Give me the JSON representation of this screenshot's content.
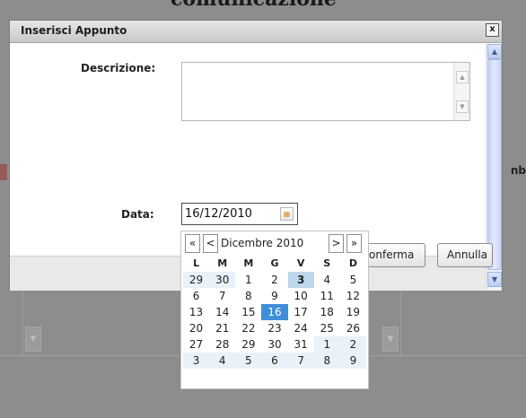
{
  "background": {
    "page_heading": "comunicazione",
    "edge_text": "nb"
  },
  "dialog": {
    "title": "Inserisci Appunto",
    "close_label": "x",
    "description_label": "Descrizione:",
    "description_value": "",
    "date_label": "Data:",
    "date_value": "16/12/2010",
    "confirm_label": "Conferma",
    "cancel_label": "Annulla"
  },
  "calendar": {
    "month_label": "Dicembre 2010",
    "nav": {
      "prev_year": "«",
      "prev_month": "<",
      "next_month": ">",
      "next_year": "»"
    },
    "weekdays": [
      "L",
      "M",
      "M",
      "G",
      "V",
      "S",
      "D"
    ],
    "weeks": [
      [
        "29",
        "30",
        "1",
        "2",
        "3",
        "4",
        "5"
      ],
      [
        "6",
        "7",
        "8",
        "9",
        "10",
        "11",
        "12"
      ],
      [
        "13",
        "14",
        "15",
        "16",
        "17",
        "18",
        "19"
      ],
      [
        "20",
        "21",
        "22",
        "23",
        "24",
        "25",
        "26"
      ],
      [
        "27",
        "28",
        "29",
        "30",
        "31",
        "1",
        "2"
      ],
      [
        "3",
        "4",
        "5",
        "6",
        "7",
        "8",
        "9"
      ]
    ],
    "selected_day": "16",
    "highlighted_day": "3"
  },
  "colors": {
    "overlay": "#8d8d8d",
    "today_bg": "#3e8fd8",
    "highlight_bg": "#bcd6ec",
    "other_month_bg": "#e9f1f9"
  },
  "icons": {
    "close": "close-icon",
    "calendar": "calendar-icon",
    "scroll_up": "chevron-up-icon",
    "scroll_down": "chevron-down-icon"
  }
}
